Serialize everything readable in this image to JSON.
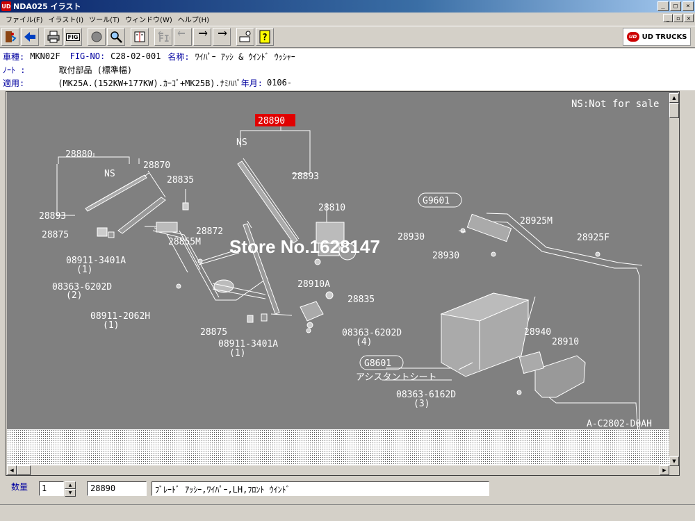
{
  "window": {
    "title": "NDA025 イラスト",
    "icon": "UD",
    "buttons": [
      "_",
      "□",
      "×"
    ]
  },
  "menu": [
    "ファイル(F)",
    "イラスト(I)",
    "ツール(T)",
    "ウィンドウ(W)",
    "ヘルプ(H)"
  ],
  "toolbar": {
    "fig_label": "FIG",
    "illust_label": "イラスト",
    "brand": "UD TRUCKS",
    "brand_icon": "UD"
  },
  "info": {
    "vehicle_label": "車種:",
    "vehicle_value": "MKN02F",
    "fig_label": "FIG-NO:",
    "fig_value": "C28-02-001",
    "name_label": "名称:",
    "name_value": "ﾜｲﾊﾟｰ ｱｯｼ & ｳｲﾝﾄﾞ ｳｯｼｬｰ",
    "note_label": "ﾉｰﾄ :",
    "note_value": "取付部品 (標準幅)",
    "apply_label": "適用:",
    "apply_value": "(MK25A.(152KW+177KW).ｶｰｺﾞ+MK25B).ﾅﾐﾊﾊﾞ",
    "year_label": "年月:",
    "year_value": "0106-"
  },
  "illustration": {
    "note": "NS:Not for sale",
    "drawing_id": "A-C2802-D0AH",
    "watermark": "Store No.1628147",
    "highlight": "28890",
    "ns_label": "NS",
    "labels": [
      "28880",
      "28870",
      "28835",
      "28893",
      "28893",
      "28875",
      "08911-3401A",
      "(1)",
      "08363-6202D",
      "(2)",
      "08911-2062H",
      "(1)",
      "28872",
      "28855M",
      "28875",
      "08911-3401A",
      "(1)",
      "28810",
      "28910A",
      "28835",
      "08363-6202D",
      "(4)",
      "G9601",
      "28930",
      "28930",
      "28925M",
      "28925F",
      "G8601",
      "アシスタントシート",
      "28940",
      "28910",
      "08363-6162D",
      "(3)"
    ]
  },
  "status": {
    "qty_label": "数量",
    "qty_value": "1",
    "part_no": "28890",
    "part_desc": "ﾌﾞﾚｰﾄﾞ ｱｯｼｰ,ﾜｲﾊﾟｰ,LH,ﾌﾛﾝﾄ ｳｲﾝﾄﾞ"
  }
}
